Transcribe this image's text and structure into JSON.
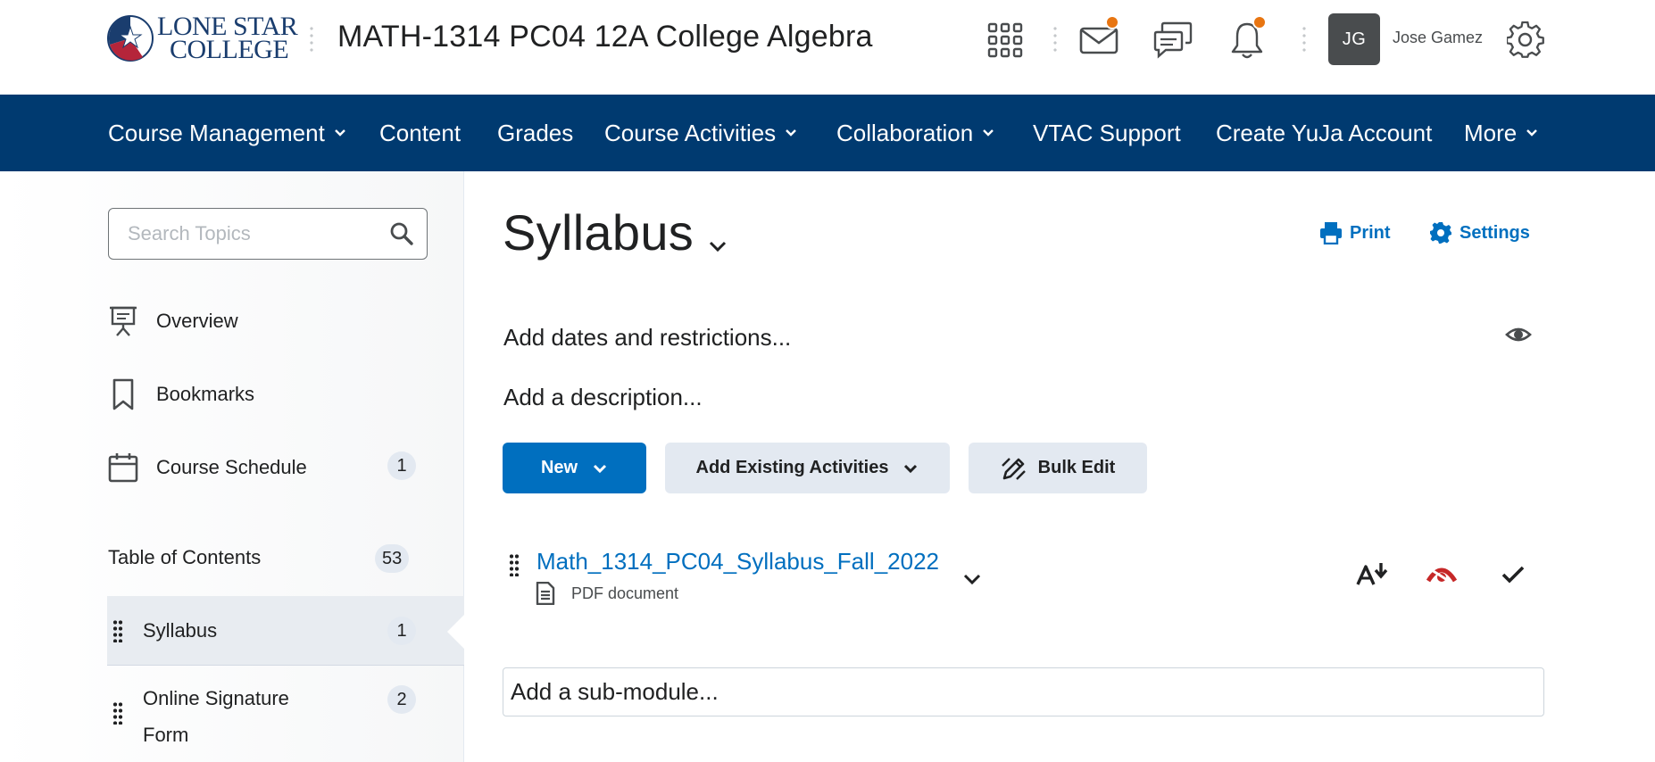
{
  "header": {
    "logo": {
      "line1": "LONE STAR",
      "line2": "COLLEGE"
    },
    "course_title": "MATH-1314 PC04 12A College Algebra",
    "icons": [
      "apps-grid-icon",
      "mail-icon",
      "chat-icon",
      "bell-icon",
      "gear-icon"
    ],
    "user": {
      "initials": "JG",
      "name": "Jose Gamez"
    },
    "badge_color": "#e87511"
  },
  "navbar": {
    "color": "#003a70",
    "items": [
      {
        "label": "Course Management",
        "dropdown": true
      },
      {
        "label": "Content",
        "dropdown": false
      },
      {
        "label": "Grades",
        "dropdown": false
      },
      {
        "label": "Course Activities",
        "dropdown": true
      },
      {
        "label": "Collaboration",
        "dropdown": true
      },
      {
        "label": "VTAC Support",
        "dropdown": false
      },
      {
        "label": "Create YuJa Account",
        "dropdown": false
      },
      {
        "label": "More",
        "dropdown": true
      }
    ]
  },
  "sidebar": {
    "search": {
      "placeholder": "Search Topics",
      "value": ""
    },
    "items": [
      {
        "label": "Overview",
        "icon": "presentation-icon",
        "count": ""
      },
      {
        "label": "Bookmarks",
        "icon": "bookmark-icon",
        "count": ""
      },
      {
        "label": "Course Schedule",
        "icon": "calendar-icon",
        "count": "1"
      }
    ],
    "toc": {
      "label": "Table of Contents",
      "count": "53",
      "modules": [
        {
          "label": "Syllabus",
          "count": "1",
          "selected": true
        },
        {
          "label_line1": "Online Signature",
          "label_line2": "Form",
          "count": "2",
          "selected": false
        }
      ]
    }
  },
  "main": {
    "title": "Syllabus",
    "print_label": "Print",
    "settings_label": "Settings",
    "add_dates": "Add dates and restrictions...",
    "add_description": "Add a description...",
    "buttons": {
      "new": "New",
      "add_existing": "Add Existing Activities",
      "bulk_edit": "Bulk Edit"
    },
    "item": {
      "title": "Math_1314_PC04_Syllabus_Fall_2022",
      "type": "PDF document"
    },
    "add_submodule": "Add a sub-module...",
    "accent_color": "#006fbf"
  }
}
